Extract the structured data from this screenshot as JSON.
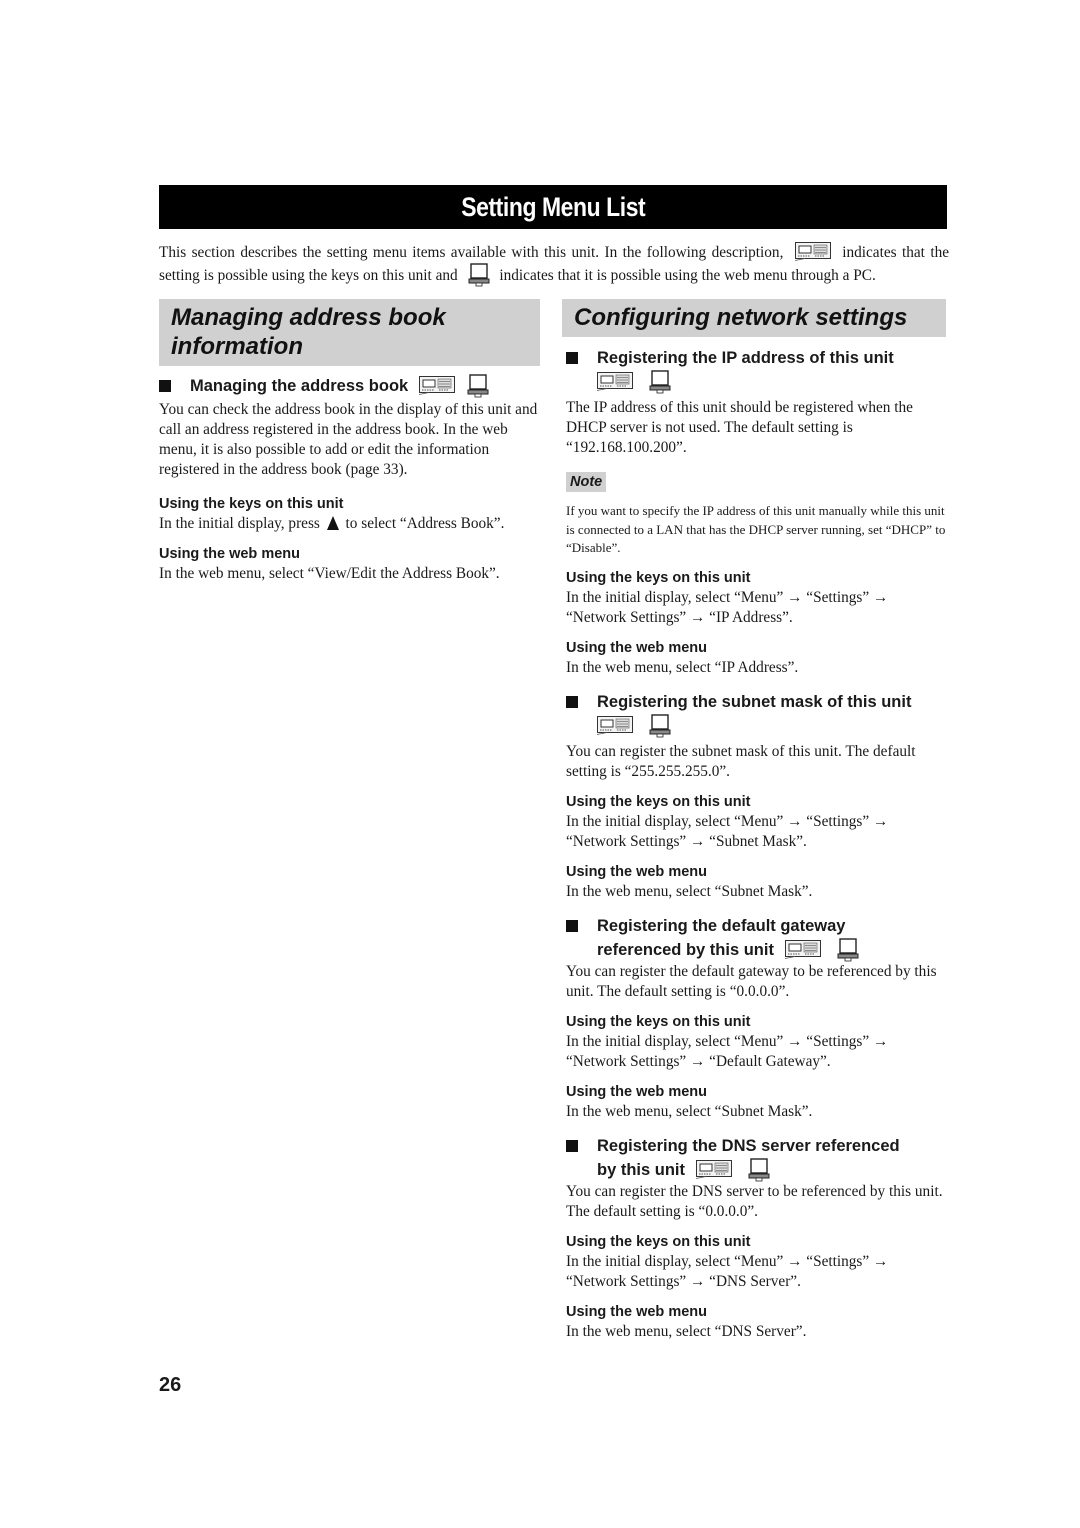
{
  "page": {
    "title": "Setting Menu List",
    "page_number": "26"
  },
  "intro": {
    "part1": "This section describes the setting menu items available with this unit. In the following description,",
    "part2": "indicates that the setting is possible using the keys on this unit and",
    "part3": "indicates that it is possible using the web menu through a PC.",
    "unit_icon": "unit-keys-icon",
    "pc_icon": "laptop-pc-icon"
  },
  "left": {
    "section_title": "Managing address book information",
    "subsection": {
      "title": "Managing the address book",
      "body": "You can check the address book in the display of this unit and call an address registered in the address book. In the web menu, it is also possible to add or edit the information registered in the address book (page 33).",
      "keys_heading": "Using the keys on this unit",
      "keys_text_before": "In the initial display, press",
      "keys_text_after": "to select “Address Book”.",
      "web_heading": "Using the web menu",
      "web_text": "In the web menu, select “View/Edit the Address Book”."
    }
  },
  "right": {
    "section_title": "Configuring network settings",
    "subsections": [
      {
        "title": "Registering the IP address of this unit",
        "body": "The IP address of this unit should be registered when the DHCP server is not used. The default setting is “192.168.100.200”.",
        "note_label": "Note",
        "note_text": "If you want to specify the IP address of this unit manually while this unit is connected to a LAN that has the DHCP server running, set “DHCP” to “Disable”.",
        "keys_heading": "Using the keys on this unit",
        "keys_text": "In the initial display, select “Menu” → “Settings” → “Network Settings” → “IP Address”.",
        "web_heading": "Using the web menu",
        "web_text": "In the web menu, select “IP Address”."
      },
      {
        "title": "Registering the subnet mask of this unit",
        "body": "You can register the subnet mask of this unit. The default setting is “255.255.255.0”.",
        "keys_heading": "Using the keys on this unit",
        "keys_text": "In the initial display, select “Menu” → “Settings” → “Network Settings” → “Subnet Mask”.",
        "web_heading": "Using the web menu",
        "web_text": "In the web menu, select “Subnet Mask”."
      },
      {
        "title_line1": "Registering the default gateway",
        "title_line2": "referenced by this unit",
        "body": "You can register the default gateway to be referenced by this unit. The default setting is “0.0.0.0”.",
        "keys_heading": "Using the keys on this unit",
        "keys_text": "In the initial display, select “Menu” → “Settings” → “Network Settings” → “Default Gateway”.",
        "web_heading": "Using the web menu",
        "web_text": "In the web menu, select “Subnet Mask”."
      },
      {
        "title_line1": "Registering the DNS server referenced",
        "title_line2": "by this unit",
        "body": "You can register the DNS server to be referenced by this unit. The default setting is “0.0.0.0”.",
        "keys_heading": "Using the keys on this unit",
        "keys_text": "In the initial display, select “Menu” → “Settings” → “Network Settings” → “DNS Server”.",
        "web_heading": "Using the web menu",
        "web_text": "In the web menu, select “DNS Server”."
      }
    ]
  }
}
